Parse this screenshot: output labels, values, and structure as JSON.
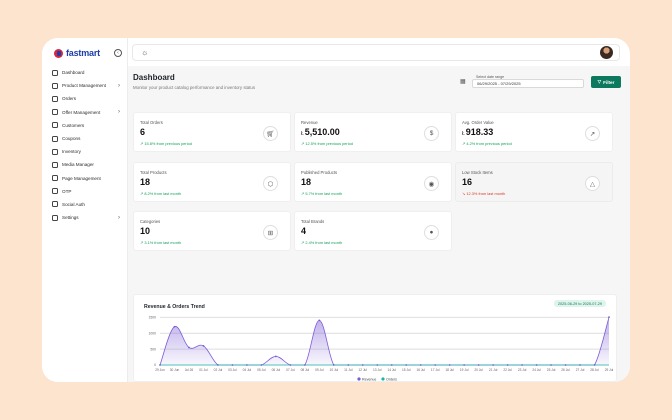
{
  "app": {
    "logo_text": "fastmart"
  },
  "sidebar": {
    "items": [
      {
        "label": "Dashboard",
        "icon": "home-icon",
        "has_chevron": false
      },
      {
        "label": "Product Management",
        "icon": "box-icon",
        "has_chevron": true
      },
      {
        "label": "Orders",
        "icon": "cart-icon",
        "has_chevron": false
      },
      {
        "label": "Offer Management",
        "icon": "tag-icon",
        "has_chevron": true
      },
      {
        "label": "Customers",
        "icon": "users-icon",
        "has_chevron": false
      },
      {
        "label": "Coupons",
        "icon": "ticket-icon",
        "has_chevron": false
      },
      {
        "label": "Inventory",
        "icon": "archive-icon",
        "has_chevron": false
      },
      {
        "label": "Media Manager",
        "icon": "image-icon",
        "has_chevron": false
      },
      {
        "label": "Page Management",
        "icon": "page-icon",
        "has_chevron": false
      },
      {
        "label": "OTP",
        "icon": "shield-icon",
        "has_chevron": false
      },
      {
        "label": "Social Auth",
        "icon": "link-icon",
        "has_chevron": false
      },
      {
        "label": "Settings",
        "icon": "gear-icon",
        "has_chevron": true
      }
    ]
  },
  "header": {
    "title": "Dashboard",
    "subtitle": "Monitor your product catalog performance and inventory status",
    "date_label": "Select date range",
    "date_value": "06/29/2025 - 07/29/2025",
    "filter_label": "Filter"
  },
  "cards": [
    {
      "label": "Total Orders",
      "value": "6",
      "currency": "",
      "change": "15.8% from previous period",
      "trend": "up",
      "icon": "cart-icon"
    },
    {
      "label": "Revenue",
      "value": "5,510.00",
      "currency": "Ł",
      "change": "12.5% from previous period",
      "trend": "up",
      "icon": "dollar-icon"
    },
    {
      "label": "Avg. Order Value",
      "value": "918.33",
      "currency": "Ł",
      "change": "4.2% from previous period",
      "trend": "up",
      "icon": "trend-up-icon"
    },
    {
      "label": "Total Products",
      "value": "18",
      "currency": "",
      "change": "8.2% from last month",
      "trend": "up",
      "icon": "package-icon"
    },
    {
      "label": "Published Products",
      "value": "18",
      "currency": "",
      "change": "5.7% from last month",
      "trend": "up",
      "icon": "eye-icon"
    },
    {
      "label": "Low Stock Items",
      "value": "16",
      "currency": "",
      "change": "12.3% from last month",
      "trend": "down",
      "icon": "warning-icon"
    },
    {
      "label": "Categories",
      "value": "10",
      "currency": "",
      "change": "3.1% from last month",
      "trend": "up",
      "icon": "grid-icon"
    },
    {
      "label": "Total Brands",
      "value": "4",
      "currency": "",
      "change": "2.4% from last month",
      "trend": "up",
      "icon": "apple-icon"
    }
  ],
  "chart": {
    "title": "Revenue & Orders Trend",
    "range_badge": "2025-06-29 to 2025-07-29"
  },
  "colors": {
    "accent": "#0d7a5f",
    "revenue": "#7c5cd6",
    "orders": "#19b6a8",
    "up": "#12a05c",
    "down": "#d83a2a"
  },
  "chart_data": {
    "type": "area",
    "title": "Revenue & Orders Trend",
    "categories": [
      "29 Jun",
      "30 Jun",
      "Jul 26",
      "01 Jul",
      "02 Jul",
      "03 Jul",
      "04 Jul",
      "05 Jul",
      "06 Jul",
      "07 Jul",
      "08 Jul",
      "09 Jul",
      "10 Jul",
      "11 Jul",
      "12 Jul",
      "13 Jul",
      "14 Jul",
      "15 Jul",
      "16 Jul",
      "17 Jul",
      "18 Jul",
      "19 Jul",
      "20 Jul",
      "21 Jul",
      "22 Jul",
      "23 Jul",
      "24 Jul",
      "25 Jul",
      "26 Jul",
      "27 Jul",
      "28 Jul",
      "29 Jul"
    ],
    "y_ticks": [
      "0",
      "500",
      "1000",
      "1500"
    ],
    "ylim": [
      0,
      1600
    ],
    "series": [
      {
        "name": "Revenue",
        "values": [
          0,
          1200,
          550,
          600,
          0,
          0,
          0,
          0,
          270,
          0,
          0,
          1400,
          0,
          0,
          0,
          0,
          0,
          0,
          0,
          0,
          0,
          0,
          0,
          0,
          0,
          0,
          0,
          0,
          0,
          0,
          0,
          1500
        ]
      },
      {
        "name": "Orders",
        "values": [
          0,
          1,
          1,
          1,
          0,
          0,
          0,
          0,
          1,
          0,
          0,
          1,
          0,
          0,
          0,
          0,
          0,
          0,
          0,
          0,
          0,
          0,
          0,
          0,
          0,
          0,
          0,
          0,
          0,
          0,
          0,
          1
        ]
      }
    ],
    "legend_position": "bottom"
  }
}
